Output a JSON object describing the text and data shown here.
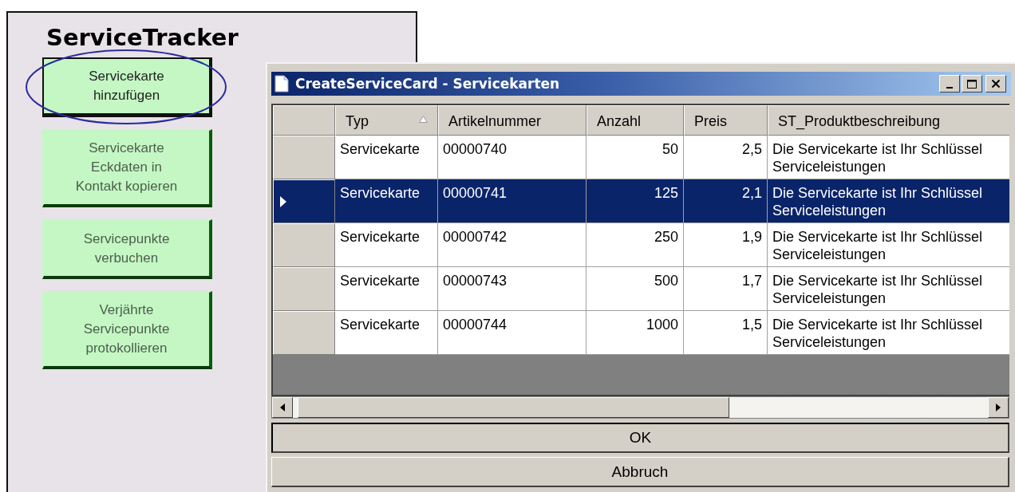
{
  "panel": {
    "title": "ServiceTracker",
    "buttons": [
      {
        "label": "Servicekarte\nhinzufügen",
        "blurred": false,
        "circled": true
      },
      {
        "label": "Servicekarte\nEckdaten in\nKontakt kopieren",
        "blurred": true,
        "circled": false
      },
      {
        "label": "Servicepunkte\nverbuchen",
        "blurred": true,
        "circled": false
      },
      {
        "label": "Verjährte\nServicepunkte\nprotokollieren",
        "blurred": true,
        "circled": false
      }
    ]
  },
  "dialog": {
    "title": "CreateServiceCard - Servicekarten",
    "columns": [
      {
        "label": "Typ",
        "kind": "text",
        "sorted": true
      },
      {
        "label": "Artikelnummer",
        "kind": "text",
        "sorted": false
      },
      {
        "label": "Anzahl",
        "kind": "number",
        "sorted": false
      },
      {
        "label": "Preis",
        "kind": "number",
        "sorted": false
      },
      {
        "label": "ST_Produktbeschreibung",
        "kind": "text",
        "sorted": false
      }
    ],
    "rows": [
      {
        "selected": false,
        "cells": [
          "Servicekarte",
          "00000740",
          "50",
          "2,5",
          "Die Servicekarte ist Ihr Schlüssel\nServiceleistungen"
        ]
      },
      {
        "selected": true,
        "cells": [
          "Servicekarte",
          "00000741",
          "125",
          "2,1",
          "Die Servicekarte ist Ihr Schlüssel\nServiceleistungen"
        ]
      },
      {
        "selected": false,
        "cells": [
          "Servicekarte",
          "00000742",
          "250",
          "1,9",
          "Die Servicekarte ist Ihr Schlüssel\nServiceleistungen"
        ]
      },
      {
        "selected": false,
        "cells": [
          "Servicekarte",
          "00000743",
          "500",
          "1,7",
          "Die Servicekarte ist Ihr Schlüssel\nServiceleistungen"
        ]
      },
      {
        "selected": false,
        "cells": [
          "Servicekarte",
          "00000744",
          "1000",
          "1,5",
          "Die Servicekarte ist Ihr Schlüssel\nServiceleistungen"
        ]
      }
    ],
    "buttons": [
      "OK",
      "Abbruch"
    ]
  }
}
